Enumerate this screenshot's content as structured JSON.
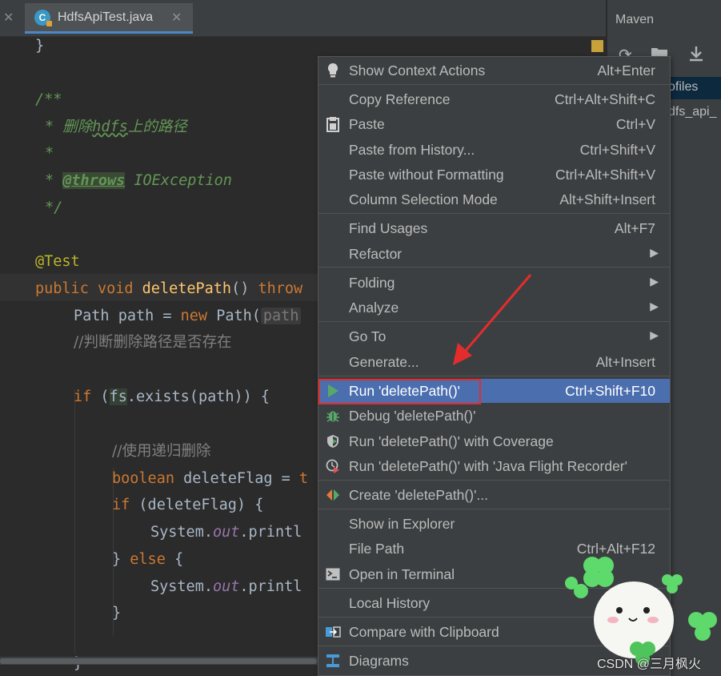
{
  "tabs": {
    "active": {
      "label": "HdfsApiTest.java",
      "icon": "java-class-icon"
    }
  },
  "maven": {
    "title": "Maven",
    "profiles_label": "ofiles",
    "project_label": "dfs_api_"
  },
  "code": {
    "line1": "}",
    "doc_open": "/**",
    "doc_star": "*",
    "doc_desc_prefix": "删除",
    "doc_desc_word": "hdfs",
    "doc_desc_suffix": "上的路径",
    "doc_tag": "@throws",
    "doc_tag_value": "IOException",
    "doc_close": "*/",
    "annotation": "@Test",
    "kw_public": "public",
    "kw_void": "void",
    "method_name": "deletePath",
    "method_parens": "() ",
    "kw_throws": "throw",
    "path_type": "Path path = ",
    "kw_new": "new",
    "path_ctor": " Path(",
    "param_hint": "path",
    "comment_check": "//判断删除路径是否存在",
    "kw_if": "if",
    "if_open": " (",
    "fs_var": "fs",
    "exists_call": ".exists(path)) {",
    "comment_recursive": "//使用递归删除",
    "kw_boolean": "boolean",
    "delete_flag_decl": " deleteFlag = ",
    "if_flag": " (deleteFlag) {",
    "sys_out": "System.",
    "out_field": "out",
    "println": ".printl",
    "close_else_prefix": "} ",
    "kw_else": "else",
    "else_brace": " {",
    "close_brace": "}",
    "trunc_t": "t",
    "last_brace": "}"
  },
  "menu": {
    "items": [
      {
        "label": "Show Context Actions",
        "shortcut": "Alt+Enter",
        "icon": "lightbulb-icon"
      },
      {
        "label": "Copy Reference",
        "shortcut": "Ctrl+Alt+Shift+C"
      },
      {
        "label": "Paste",
        "shortcut": "Ctrl+V",
        "icon": "clipboard-icon"
      },
      {
        "label": "Paste from History...",
        "shortcut": "Ctrl+Shift+V"
      },
      {
        "label": "Paste without Formatting",
        "shortcut": "Ctrl+Alt+Shift+V"
      },
      {
        "label": "Column Selection Mode",
        "shortcut": "Alt+Shift+Insert"
      },
      {
        "label": "Find Usages",
        "shortcut": "Alt+F7"
      },
      {
        "label": "Refactor",
        "shortcut": ""
      },
      {
        "label": "Folding",
        "shortcut": ""
      },
      {
        "label": "Analyze",
        "shortcut": ""
      },
      {
        "label": "Go To",
        "shortcut": ""
      },
      {
        "label": "Generate...",
        "shortcut": "Alt+Insert"
      },
      {
        "label": "Run 'deletePath()'",
        "shortcut": "Ctrl+Shift+F10",
        "icon": "run-icon"
      },
      {
        "label": "Debug 'deletePath()'",
        "shortcut": "",
        "icon": "debug-icon"
      },
      {
        "label": "Run 'deletePath()' with Coverage",
        "shortcut": "",
        "icon": "coverage-icon"
      },
      {
        "label": "Run 'deletePath()' with 'Java Flight Recorder'",
        "shortcut": "",
        "icon": "flight-recorder-icon"
      },
      {
        "label": "Create 'deletePath()'...",
        "shortcut": "",
        "icon": "create-config-icon"
      },
      {
        "label": "Show in Explorer",
        "shortcut": ""
      },
      {
        "label": "File Path",
        "shortcut": "Ctrl+Alt+F12"
      },
      {
        "label": "Open in Terminal",
        "shortcut": "",
        "icon": "terminal-icon"
      },
      {
        "label": "Local History",
        "shortcut": ""
      },
      {
        "label": "Compare with Clipboard",
        "shortcut": "",
        "icon": "compare-icon"
      },
      {
        "label": "Diagrams",
        "shortcut": "",
        "icon": "diagram-icon"
      }
    ],
    "selected_index": 12,
    "submenu_arrow": "▶"
  },
  "watermark": "CSDN @三月枫火",
  "colors": {
    "selection": "#4b6eaf",
    "highlight_box": "#e32d2d",
    "annotation_arrow": "#e32d2d"
  }
}
